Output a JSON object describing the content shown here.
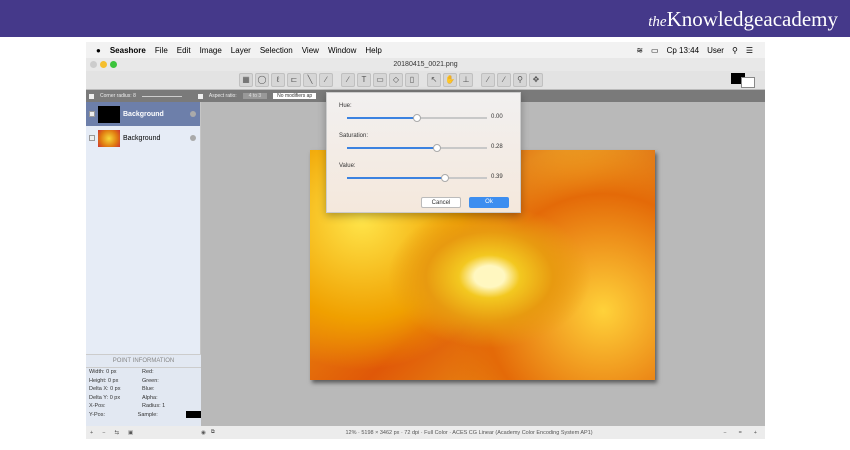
{
  "brand": {
    "prefix": "the",
    "name": "Knowledgeacademy"
  },
  "menubar": {
    "apple": "",
    "items": [
      "Seashore",
      "File",
      "Edit",
      "Image",
      "Layer",
      "Selection",
      "View",
      "Window",
      "Help"
    ],
    "clock": "Cp 13:44",
    "user": "User"
  },
  "window": {
    "title": "20180415_0021.png"
  },
  "toolbar": {
    "tools": [
      "▦",
      "◯",
      "ℓ",
      "⊏",
      "╲",
      "∕",
      "∕",
      "T",
      "▭",
      "◇",
      "▯",
      "↖",
      "✋",
      "⊥",
      "∕",
      "∕",
      "⚲",
      "✥"
    ],
    "foreground": "#000000",
    "background": "#ffffff"
  },
  "options": {
    "corner_radius": "Corner radius: 8",
    "aspect_ratio": "Aspect ratio:",
    "ratio_value": "4 to 3",
    "modifiers": "No modifiers ap"
  },
  "layers": [
    {
      "name": "Background",
      "selected": true
    },
    {
      "name": "Background",
      "selected": false
    }
  ],
  "point_info": {
    "title": "POINT INFORMATION",
    "rows": [
      [
        "Width: 0 px",
        "Red:"
      ],
      [
        "Height: 0 px",
        "Green:"
      ],
      [
        "Delta X: 0 px",
        "Blue:"
      ],
      [
        "Delta Y: 0 px",
        "Alpha:"
      ],
      [
        "X-Pos:",
        "Radius: 1"
      ],
      [
        "Y-Pos:",
        "Sample:"
      ]
    ]
  },
  "dialog": {
    "sliders": [
      {
        "label": "Hue:",
        "value": "0.00",
        "fraction": 0.5
      },
      {
        "label": "Saturation:",
        "value": "0.28",
        "fraction": 0.64
      },
      {
        "label": "Value:",
        "value": "0.39",
        "fraction": 0.7
      }
    ],
    "cancel": "Cancel",
    "ok": "Ok"
  },
  "status": {
    "text": "12% · 5198 × 3462 px · 72 dpi · Full Color · ACES CG Linear (Academy Color Encoding System AP1)",
    "zoom_out": "−",
    "zoom_reset": "=",
    "zoom_in": "+"
  },
  "bottom_left": [
    "+",
    "−",
    "⇆",
    "▣"
  ],
  "colors": {
    "banner": "#45398a",
    "accent": "#3d8ef0",
    "selected_layer": "#6d7faa"
  }
}
